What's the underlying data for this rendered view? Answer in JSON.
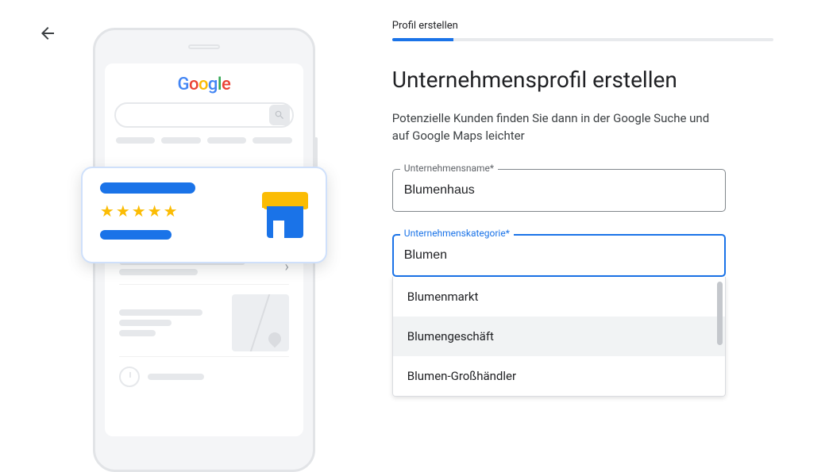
{
  "step_label": "Profil erstellen",
  "heading": "Unternehmensprofil erstellen",
  "subtext": "Potenzielle Kunden finden Sie dann in der Google Suche und auf Google Maps leichter",
  "name_field": {
    "label": "Unternehmensname*",
    "value": "Blumenhaus"
  },
  "category_field": {
    "label": "Unternehmenskategorie*",
    "value": "Blumen"
  },
  "suggestions": [
    "Blumenmarkt",
    "Blumengeschäft",
    "Blumen-Großhändler"
  ],
  "logo": {
    "letters": [
      "G",
      "o",
      "o",
      "g",
      "l",
      "e"
    ]
  }
}
